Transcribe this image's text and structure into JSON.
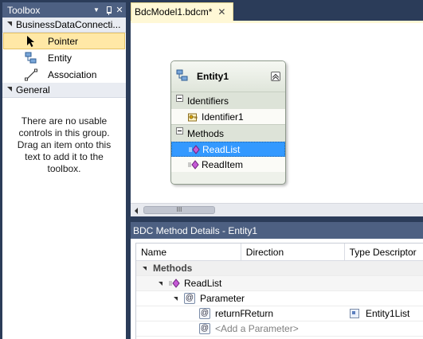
{
  "toolbox": {
    "title": "Toolbox",
    "dropdown_glyph": "▼",
    "close_glyph": "✕",
    "group1": {
      "label": "BusinessDataConnecti...",
      "items": [
        {
          "label": "Pointer",
          "icon": "pointer-icon",
          "selected": true
        },
        {
          "label": "Entity",
          "icon": "entity-icon",
          "selected": false
        },
        {
          "label": "Association",
          "icon": "association-icon",
          "selected": false
        }
      ]
    },
    "group2": {
      "label": "General",
      "empty_text": "There are no usable controls in this group. Drag an item onto this text to add it to the toolbox."
    }
  },
  "designer": {
    "tab_label": "BdcModel1.bdcm*",
    "tab_close": "✕",
    "scroll_thumb_glyph": "III",
    "entity": {
      "title": "Entity1",
      "identifiers_label": "Identifiers",
      "identifier": "Identifier1",
      "methods_label": "Methods",
      "methods": [
        {
          "label": "ReadList",
          "selected": true
        },
        {
          "label": "ReadItem",
          "selected": false
        }
      ]
    }
  },
  "details": {
    "title": "BDC Method Details - Entity1",
    "columns": [
      "Name",
      "Direction",
      "Type Descriptor"
    ],
    "rows": {
      "methods": "Methods",
      "readlist": "ReadList",
      "parameter": "Parameter",
      "return_name": "returnP",
      "return_direction": "Return",
      "return_type": "Entity1List",
      "add_parameter": "<Add a Parameter>"
    }
  },
  "colors": {
    "title_bar": "#4d6082",
    "background": "#2b3c59",
    "selection": "#3399ff",
    "toolbox_selected": "#ffe8a6",
    "tab": "#fff8d6"
  }
}
